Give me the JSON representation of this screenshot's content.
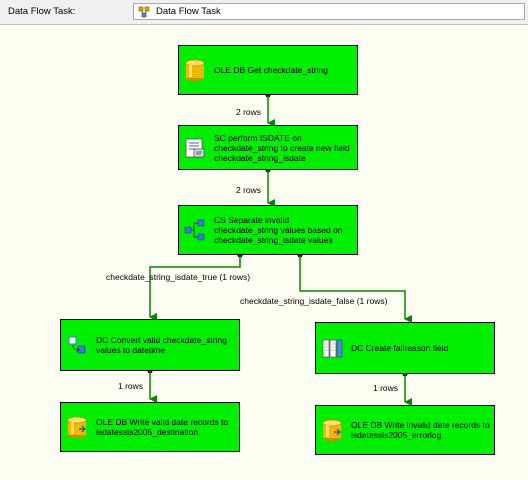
{
  "toolbar": {
    "task_label": "Data Flow Task:",
    "task_value": "Data Flow Task",
    "task_icon": "data-flow-task-icon"
  },
  "nodes": [
    {
      "id": "n1",
      "icon": "database-icon",
      "text": "OLE DB Get checkdate_string"
    },
    {
      "id": "n2",
      "icon": "script-component-icon",
      "text": "SC perform ISDATE on checkdate_string to create new field checkdate_string_isdate"
    },
    {
      "id": "n3",
      "icon": "conditional-split-icon",
      "text": "CS Separate invalid checkdate_string values based on checkdate_string_isdate values"
    },
    {
      "id": "n4",
      "icon": "data-conversion-icon",
      "text": "DC Convert valid checkdate_string values to datetime"
    },
    {
      "id": "n5",
      "icon": "derived-column-icon",
      "text": "DC Create failreason field"
    },
    {
      "id": "n6",
      "icon": "database-icon",
      "text": "OLE DB Write valid date records to isdatessis2005_destination"
    },
    {
      "id": "n7",
      "icon": "database-icon",
      "text": "OLE DB Write invalid date records to isdatessis2005_errorlog"
    }
  ],
  "edges": [
    {
      "from": "n1",
      "to": "n2",
      "label": "2 rows"
    },
    {
      "from": "n2",
      "to": "n3",
      "label": "2 rows"
    },
    {
      "from": "n3",
      "to": "n4",
      "label": "checkdate_string_isdate_true (1 rows)"
    },
    {
      "from": "n3",
      "to": "n5",
      "label": "checkdate_string_isdate_false (1 rows)"
    },
    {
      "from": "n4",
      "to": "n6",
      "label": "1 rows"
    },
    {
      "from": "n5",
      "to": "n7",
      "label": "1 rows"
    }
  ],
  "colors": {
    "node_fill": "#00ee00",
    "arrow": "#008800",
    "canvas": "#fffff4"
  }
}
